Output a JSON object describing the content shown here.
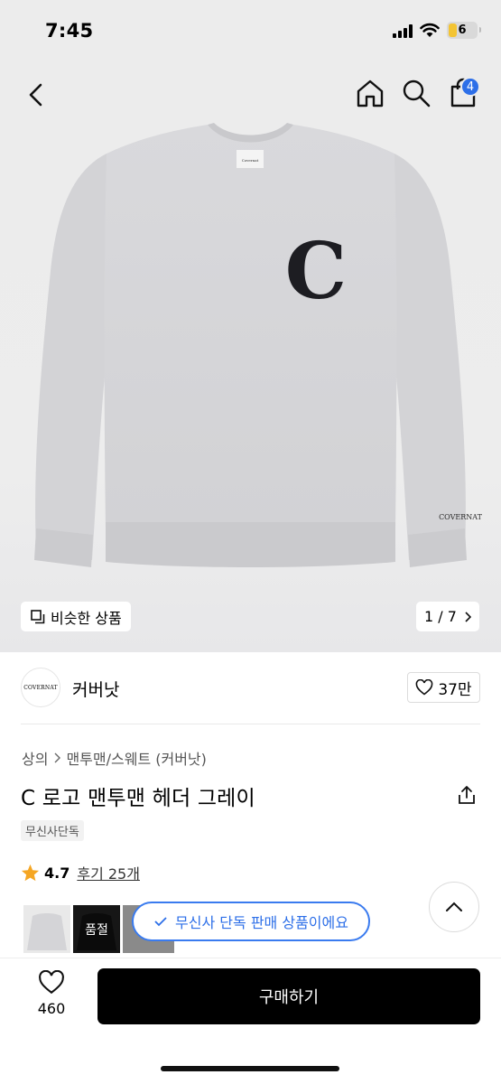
{
  "status_bar": {
    "time": "7:45",
    "battery": "6"
  },
  "header": {
    "cart_count": "4"
  },
  "gallery": {
    "similar_label": "비슷한 상품",
    "page_indicator": "1 / 7",
    "logo_text": "C",
    "brand_embroidery": "COVERNAT"
  },
  "brand": {
    "logo_text": "COVERNAT",
    "name": "커버낫",
    "likes": "37만"
  },
  "breadcrumb": {
    "category": "상의",
    "subcategory": "맨투맨/스웨트 (커버낫)"
  },
  "product": {
    "title": "C 로고 맨투맨 헤더 그레이",
    "tag": "무신사단독",
    "rating": "4.7",
    "reviews": "후기 25개"
  },
  "thumbnails": {
    "soldout_label": "품절"
  },
  "toast": {
    "message": "무신사 단독 판매 상품이에요"
  },
  "bottom_bar": {
    "wish_count": "460",
    "buy_label": "구매하기"
  },
  "colors": {
    "accent": "#2d6fe8",
    "star": "#f5a623",
    "buy_button": "#000000"
  }
}
